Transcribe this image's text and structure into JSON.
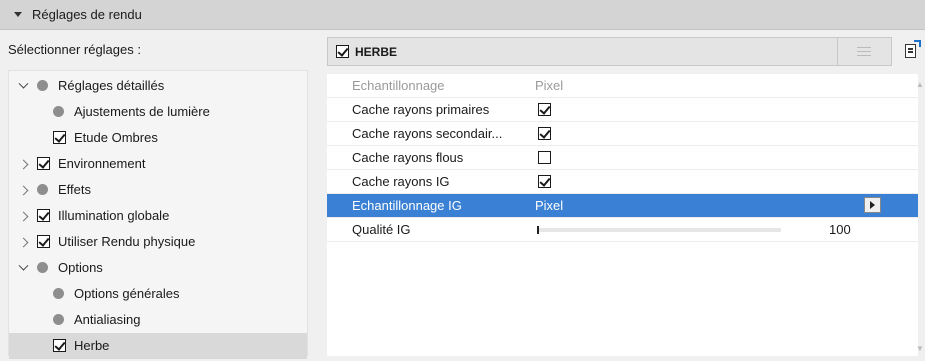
{
  "panel": {
    "title": "Réglages de rendu"
  },
  "left": {
    "label": "Sélectionner réglages :",
    "tree": [
      {
        "label": "Réglages détaillés",
        "expander": "down",
        "marker": "dot",
        "level": 0,
        "selected": false
      },
      {
        "label": "Ajustements de lumière",
        "expander": "none",
        "marker": "dot",
        "level": 1,
        "selected": false
      },
      {
        "label": "Etude Ombres",
        "expander": "none",
        "marker": "checked",
        "level": 1,
        "selected": false
      },
      {
        "label": "Environnement",
        "expander": "right",
        "marker": "checked",
        "level": 0,
        "selected": false
      },
      {
        "label": "Effets",
        "expander": "right",
        "marker": "dot",
        "level": 0,
        "selected": false
      },
      {
        "label": "Illumination globale",
        "expander": "right",
        "marker": "checked",
        "level": 0,
        "selected": false
      },
      {
        "label": "Utiliser Rendu physique",
        "expander": "right",
        "marker": "checked",
        "level": 0,
        "selected": false
      },
      {
        "label": "Options",
        "expander": "down",
        "marker": "dot",
        "level": 0,
        "selected": false
      },
      {
        "label": "Options générales",
        "expander": "none",
        "marker": "dot",
        "level": 1,
        "selected": false
      },
      {
        "label": "Antialiasing",
        "expander": "none",
        "marker": "dot",
        "level": 1,
        "selected": false
      },
      {
        "label": "Herbe",
        "expander": "none",
        "marker": "checked",
        "level": 1,
        "selected": true
      }
    ]
  },
  "right": {
    "header": {
      "name": "HERBE",
      "checked": true
    },
    "rows": [
      {
        "name": "Echantillonnage",
        "type": "text",
        "value": "Pixel",
        "disabled": true,
        "selected": false
      },
      {
        "name": "Cache rayons primaires",
        "type": "checkbox",
        "checked": true,
        "disabled": false,
        "selected": false
      },
      {
        "name": "Cache rayons secondair...",
        "type": "checkbox",
        "checked": true,
        "disabled": false,
        "selected": false
      },
      {
        "name": "Cache rayons flous",
        "type": "checkbox",
        "checked": false,
        "disabled": false,
        "selected": false
      },
      {
        "name": "Cache rayons IG",
        "type": "checkbox",
        "checked": true,
        "disabled": false,
        "selected": false
      },
      {
        "name": "Echantillonnage IG",
        "type": "select",
        "value": "Pixel",
        "disabled": false,
        "selected": true
      },
      {
        "name": "Qualité IG",
        "type": "slider",
        "value": "100",
        "fraction": 0.0,
        "disabled": false,
        "selected": false
      }
    ]
  },
  "colors": {
    "selection": "#3a80d4",
    "tree_selection": "#d9d9d9",
    "header_bg": "#d4d4d4"
  },
  "icons": {
    "collapse": "triangle-down-icon",
    "list": "list-view-icon",
    "doc": "document-link-icon"
  }
}
